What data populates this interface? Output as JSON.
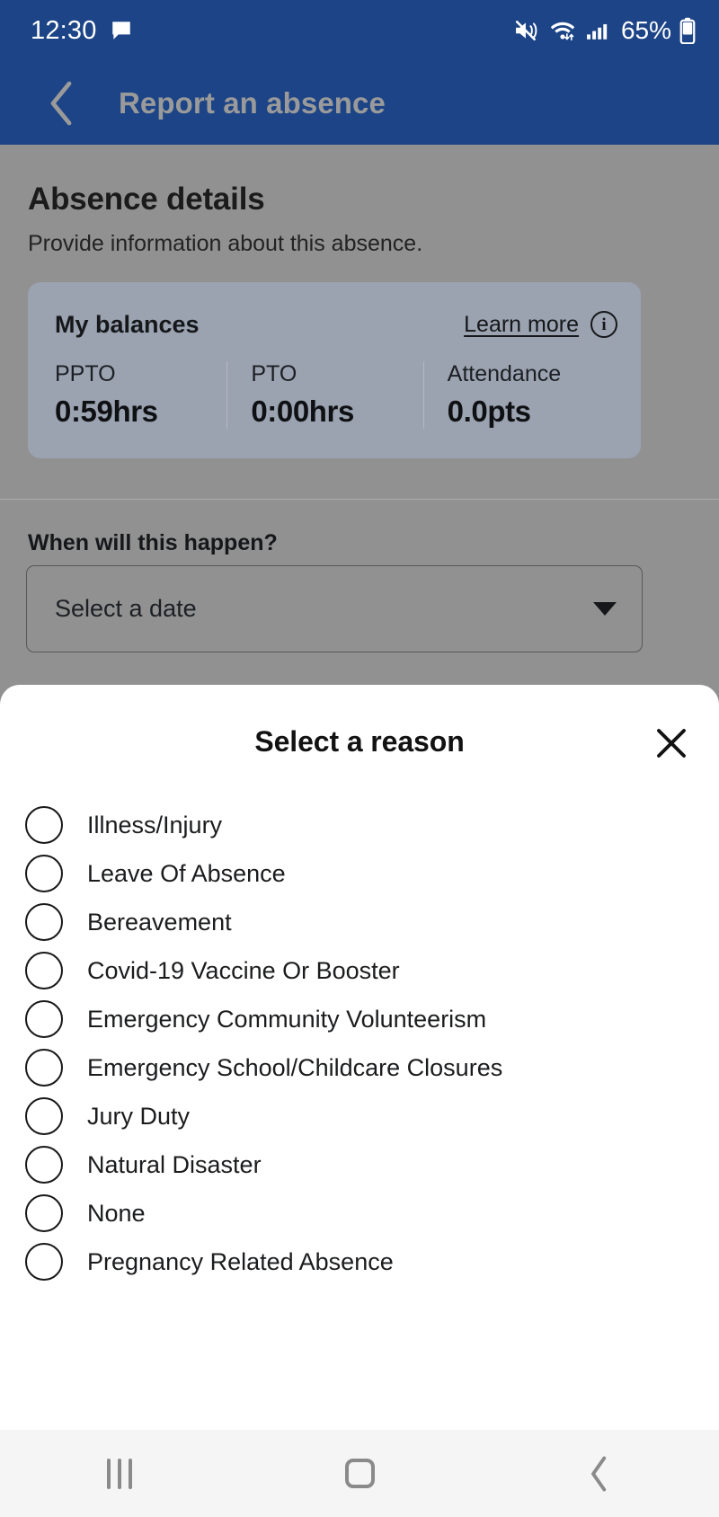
{
  "status_bar": {
    "clock": "12:30",
    "battery_percent": "65%",
    "icons": [
      "message-icon",
      "mute-icon",
      "wifi-icon",
      "signal-icon",
      "battery-icon"
    ]
  },
  "app_bar": {
    "back_icon": "chevron-left-icon",
    "title": "Report an absence",
    "background_color": "#1c4486",
    "title_color": "#9a9a9a"
  },
  "page": {
    "title": "Absence details",
    "subtitle": "Provide information about this absence."
  },
  "balances_card": {
    "title": "My balances",
    "learn_more_label": "Learn more",
    "info_icon": "info-circle-icon",
    "info_glyph": "i",
    "items": [
      {
        "label": "PPTO",
        "value": "0:59hrs"
      },
      {
        "label": "PTO",
        "value": "0:00hrs"
      },
      {
        "label": "Attendance",
        "value": "0.0pts"
      }
    ]
  },
  "when_section": {
    "label": "When will this happen?",
    "date_placeholder": "Select a date",
    "caret_icon": "caret-down-icon"
  },
  "sheet": {
    "title": "Select a reason",
    "close_icon": "close-icon",
    "options": [
      {
        "label": "Illness/Injury",
        "selected": false
      },
      {
        "label": "Leave Of Absence",
        "selected": false
      },
      {
        "label": "Bereavement",
        "selected": false
      },
      {
        "label": "Covid-19 Vaccine Or Booster",
        "selected": false
      },
      {
        "label": "Emergency Community Volunteerism",
        "selected": false
      },
      {
        "label": "Emergency School/Childcare Closures",
        "selected": false
      },
      {
        "label": "Jury Duty",
        "selected": false
      },
      {
        "label": "Natural Disaster",
        "selected": false
      },
      {
        "label": "None",
        "selected": false
      },
      {
        "label": "Pregnancy Related Absence",
        "selected": false
      }
    ]
  },
  "nav_bar": {
    "recents_icon": "recents-icon",
    "home_icon": "home-icon",
    "back_icon": "back-icon"
  }
}
